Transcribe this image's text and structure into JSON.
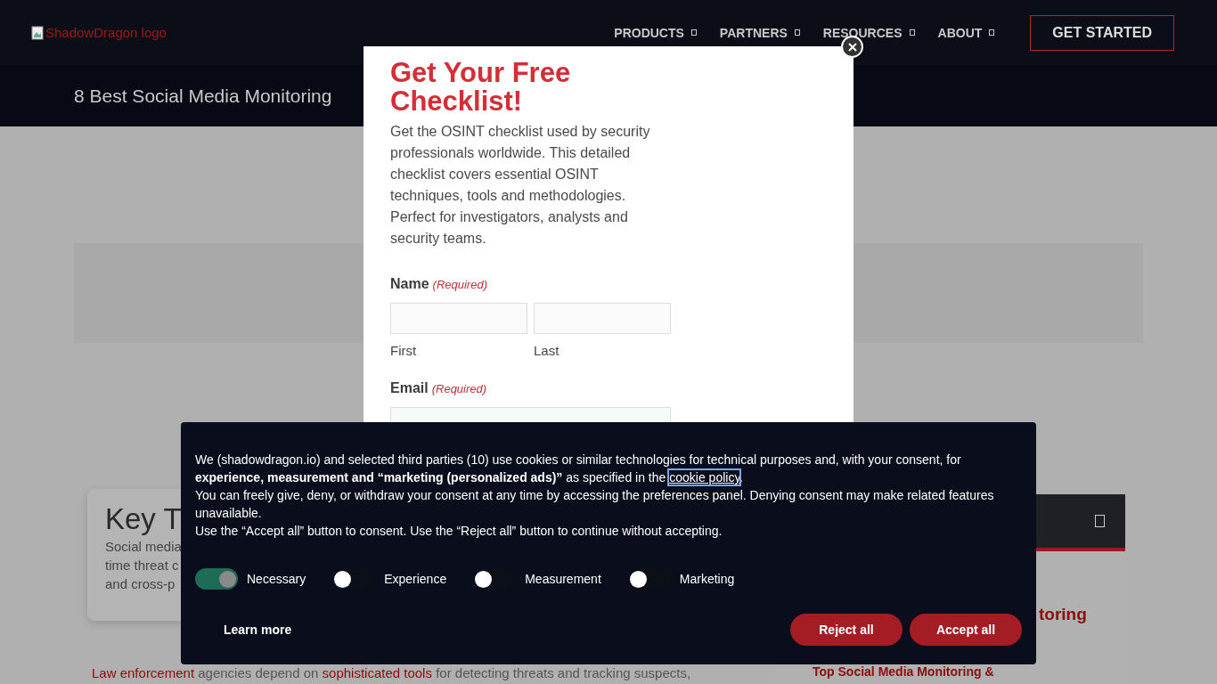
{
  "header": {
    "logo_alt": "ShadowDragon logo",
    "nav": [
      {
        "label": "PRODUCTS"
      },
      {
        "label": "PARTNERS"
      },
      {
        "label": "RESOURCES"
      },
      {
        "label": "ABOUT"
      }
    ],
    "cta": "GET STARTED"
  },
  "page_title": "8 Best Social Media Monitoring",
  "card": {
    "title": "Key T",
    "lines": [
      "Social media",
      "time threat c",
      "and cross-p"
    ]
  },
  "body_paragraph": [
    {
      "text": "Law enforcement",
      "link": true
    },
    {
      "text": "agencies depend on",
      "link": false
    },
    {
      "text": "sophisticated tools",
      "link": true
    },
    {
      "text": "for detecting threats and tracking suspects,",
      "link": false
    }
  ],
  "sidebar": {
    "heading_fragment": "toring",
    "next_heading": "Top Social Media Monitoring &"
  },
  "modal": {
    "title": "Get Your Free Checklist!",
    "description": "Get the OSINT checklist used by security professionals worldwide. This detailed checklist covers essential OSINT techniques, tools and methodologies. Perfect for investigators, analysts and security teams.",
    "fields": [
      {
        "kind": "split",
        "label": "Name",
        "required": "(Required)",
        "inputs": [
          {
            "sublabel": "First"
          },
          {
            "sublabel": "Last"
          }
        ]
      },
      {
        "kind": "single",
        "label": "Email",
        "required": "(Required)"
      }
    ]
  },
  "cookie_banner": {
    "intro": {
      "text": "We (shadowdragon.io) and selected third parties (10) use cookies or similar technologies for technical purposes and, with your consent, for **experience, measurement and “marketing (personalized ads)”** as specified in the",
      "link": "cookie policy",
      "after": "."
    },
    "paragraphs": [
      "You can freely give, deny, or withdraw your consent at any time by accessing the preferences panel. Denying consent may make related features unavailable.",
      "Use the “Accept all” button to consent. Use the “Reject all” button to continue without accepting."
    ],
    "toggles": [
      {
        "label": "Necessary",
        "on": true
      },
      {
        "label": "Experience",
        "on": false
      },
      {
        "label": "Measurement",
        "on": false
      },
      {
        "label": "Marketing",
        "on": false
      }
    ],
    "learn_more": "Learn more",
    "buttons": [
      "Reject all",
      "Accept all"
    ]
  }
}
